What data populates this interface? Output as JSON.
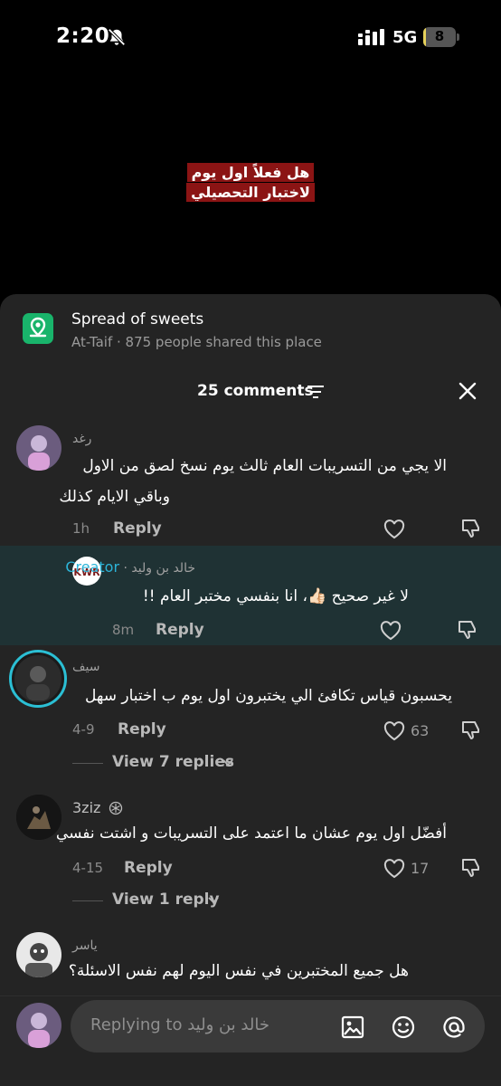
{
  "status": {
    "time": "2:20",
    "network": "5G",
    "battery": "8",
    "battery_fraction": 0.08
  },
  "video": {
    "caption_line1": "هل فعلاً اول يوم",
    "caption_line2": "لاختبار التحصيلي"
  },
  "place": {
    "title": "Spread of sweets",
    "subtitle": "At-Taif · 875 people shared this place"
  },
  "header": {
    "count_label": "25 comments"
  },
  "common": {
    "reply_label": "Reply"
  },
  "comments": [
    {
      "user": "رغد",
      "text_line1": "الا يجي من التسريبات العام ثالث يوم نسخ لصق من الاول",
      "text_line2": "وباقي الايام كذلك",
      "time": "1h"
    },
    {
      "user": "خالد بن وليد",
      "creator_label": "Creator",
      "text": "لا غير صحيح 👍🏻، انا بنفسي مختبر العام !!",
      "time": "8m"
    },
    {
      "user": "سيف",
      "text": "يحسبون قياس تكافئ الي يختبرون اول يوم ب اختبار سهل",
      "time": "4-9",
      "likes": "63",
      "view_replies": "View 7 replies"
    },
    {
      "user": "3ziz",
      "text": "أفضّل اول يوم عشان ما اعتمد على التسريبات و اشتت نفسي",
      "time": "4-15",
      "likes": "17",
      "view_replies": "View 1 reply"
    },
    {
      "user": "ياسر",
      "text": "هل جميع المختبرين في نفس اليوم لهم نفس الاسئلة؟"
    }
  ],
  "input": {
    "placeholder": "Replying to خالد بن وليد"
  },
  "colors": {
    "sheet_bg": "#242424",
    "highlight_bg": "#1f3234",
    "creator": "#2cb4d8",
    "place_icon": "#19b46b",
    "caption_bg": "#8b1414"
  },
  "icons": [
    "bell-slash-icon",
    "signal-icon",
    "battery-icon",
    "location-pin-icon",
    "filter-icon",
    "close-icon",
    "heart-icon",
    "dislike-icon",
    "chevron-down-icon",
    "image-icon",
    "emoji-icon",
    "mention-icon"
  ]
}
